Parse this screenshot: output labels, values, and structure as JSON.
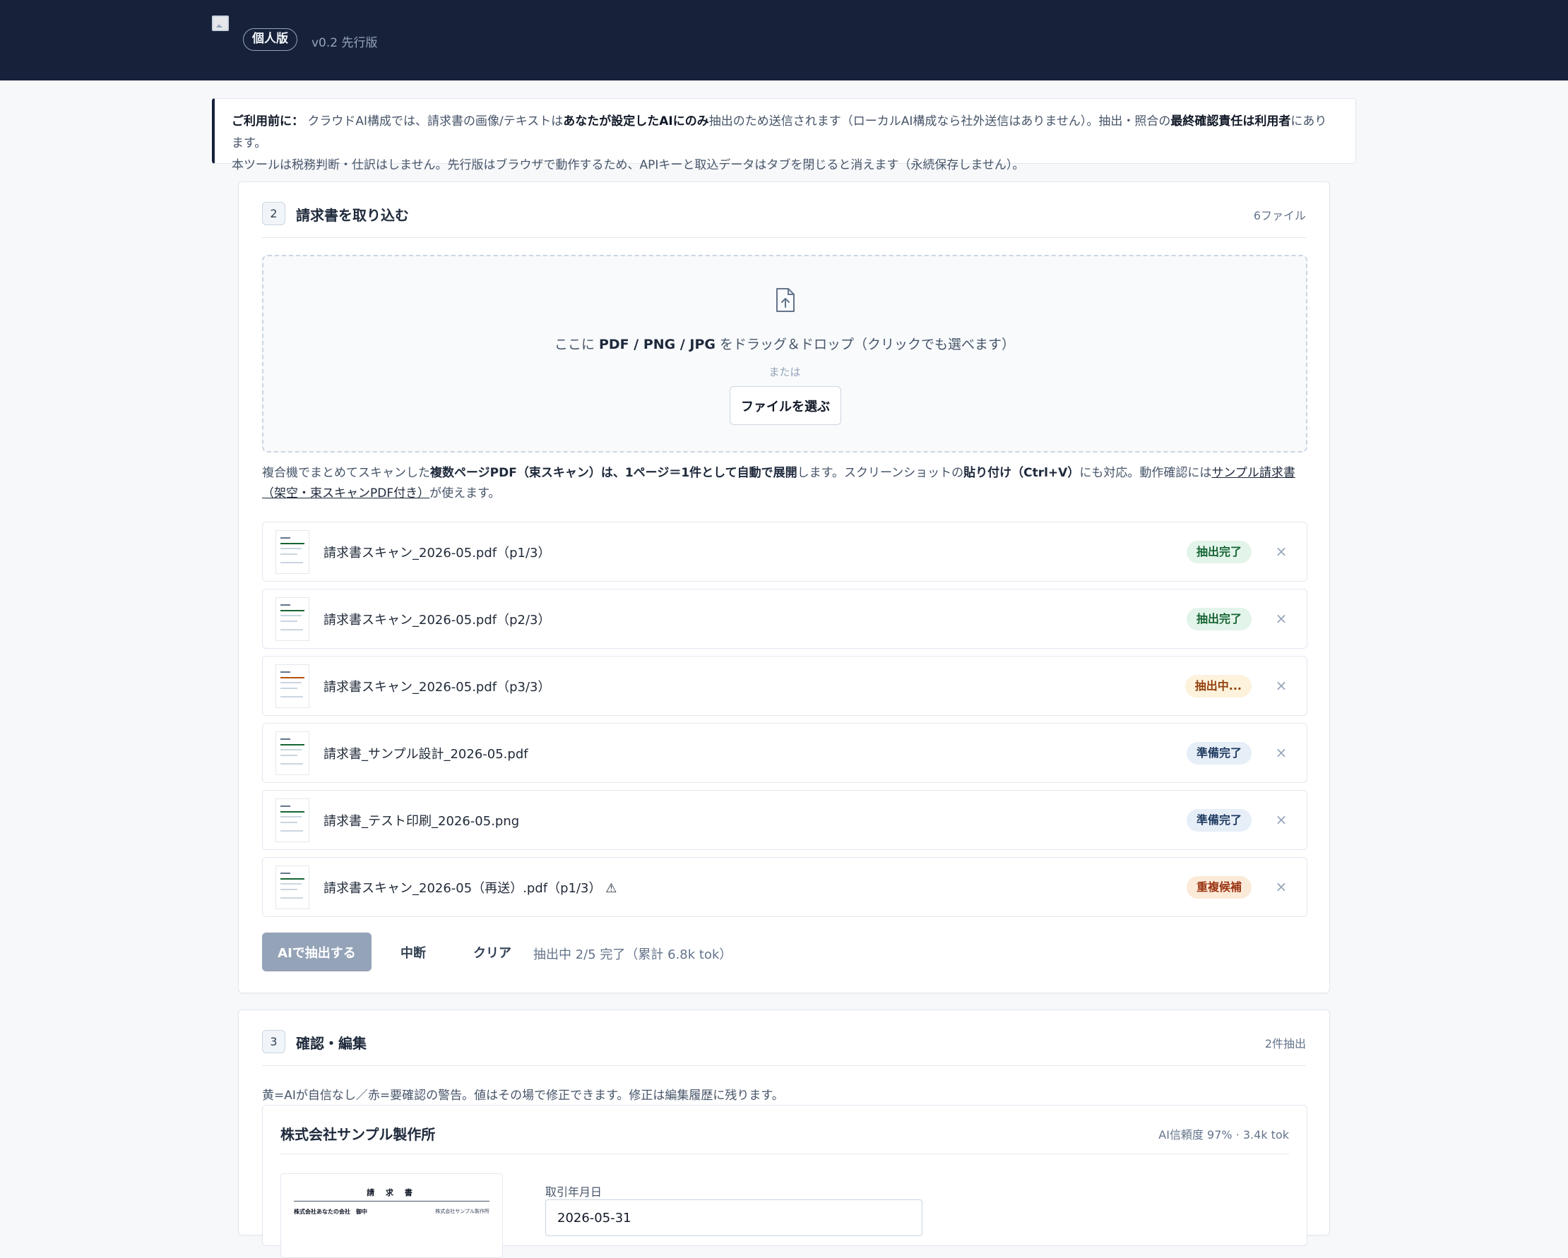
{
  "header": {
    "edition_badge": "個人版",
    "version": "v0.2 先行版"
  },
  "notice": {
    "lead": "ご利用前に：",
    "t1": " クラウドAI構成では、請求書の画像/テキストは",
    "b1": "あなたが設定したAIにのみ",
    "t2": "抽出のため送信されます（ローカルAI構成なら社外送信はありません）。抽出・照合の",
    "b2": "最終確認責任は利用者",
    "t3": "にあります。",
    "line2": "本ツールは税務判断・仕訳はしません。先行版はブラウザで動作するため、APIキーと取込データはタブを閉じると消えます（永続保存しません）。"
  },
  "import_section": {
    "step": "2",
    "title": "請求書を取り込む",
    "file_count": "6ファイル",
    "dropzone": {
      "prefix": "ここに ",
      "formats": "PDF / PNG / JPG",
      "suffix": " をドラッグ＆ドロップ（クリックでも選べます）",
      "or": "または",
      "choose_button": "ファイルを選ぶ"
    },
    "helper": {
      "t1": "複合機でまとめてスキャンした",
      "b1": "複数ページPDF（束スキャン）は、1ページ＝1件として自動で展開",
      "t2": "します。スクリーンショットの",
      "b2": "貼り付け（Ctrl+V）",
      "t3": "にも対応。動作確認には",
      "link": "サンプル請求書（架空・束スキャンPDF付き）",
      "t4": "が使えます。"
    },
    "files": [
      {
        "name": "請求書スキャン_2026-05.pdf（p1/3）",
        "status": "抽出完了"
      },
      {
        "name": "請求書スキャン_2026-05.pdf（p2/3）",
        "status": "抽出完了"
      },
      {
        "name": "請求書スキャン_2026-05.pdf（p3/3）",
        "status": "抽出中..."
      },
      {
        "name": "請求書_サンプル設計_2026-05.pdf",
        "status": "準備完了"
      },
      {
        "name": "請求書_テスト印刷_2026-05.png",
        "status": "準備完了"
      },
      {
        "name": "請求書スキャン_2026-05（再送）.pdf（p1/3） ⚠",
        "status": "重複候補"
      }
    ],
    "remove_glyph": "×",
    "actions": {
      "extract": "AIで抽出する",
      "stop": "中断",
      "clear": "クリア",
      "progress": "抽出中 2/5 完了（累計 6.8k tok）"
    }
  },
  "review_section": {
    "step": "3",
    "title": "確認・編集",
    "extracted_count": "2件抽出",
    "hint": "黄=AIが自信なし／赤=要確認の警告。値はその場で修正できます。修正は編集履歴に残ります。",
    "invoice": {
      "company": "株式会社サンプル製作所",
      "confidence": "AI信頼度 97% · 3.4k tok",
      "preview_title": "請 求 書",
      "preview_to": "株式会社あなたの会社　御中",
      "preview_from": "株式会社サンプル製作所",
      "date_label": "取引年月日",
      "date_value": "2026-05-31"
    }
  }
}
